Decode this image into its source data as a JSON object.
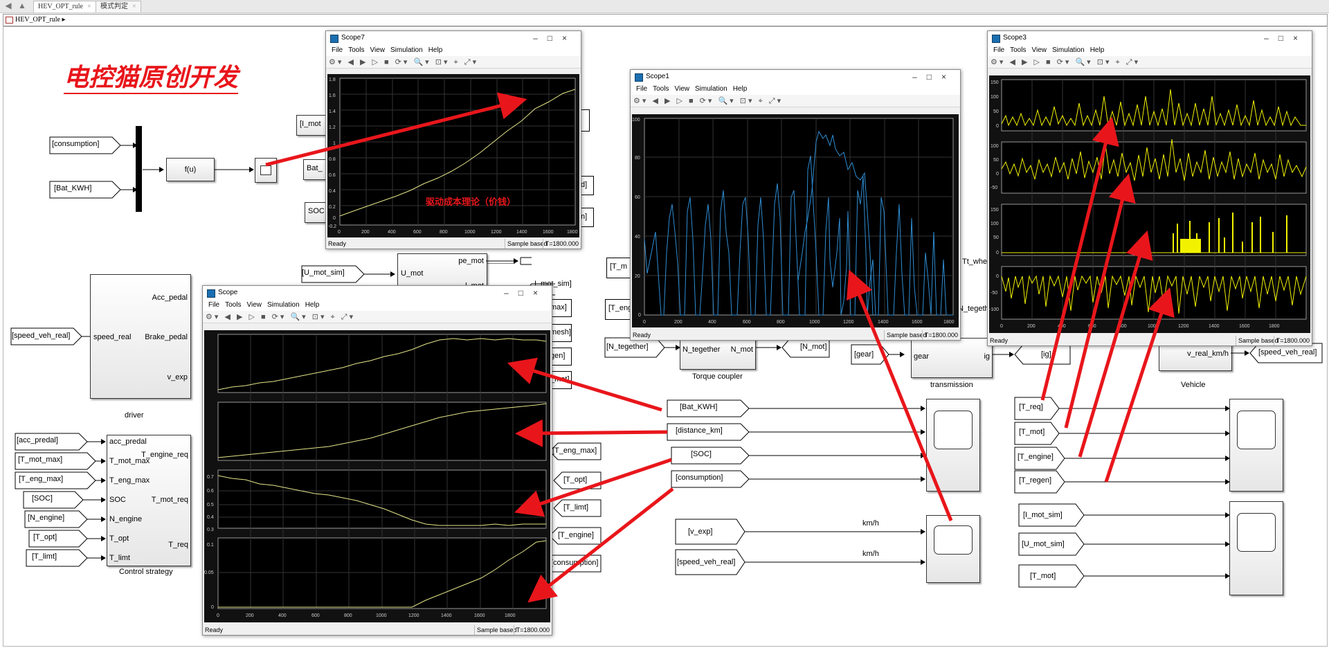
{
  "tabs": {
    "tab1": "HEV_OPT_rule",
    "tab2": "模式判定"
  },
  "address": {
    "path": "HEV_OPT_rule"
  },
  "banner": {
    "text": "电控猫原创开发"
  },
  "top_left": {
    "tag_consumption": "[consumption]",
    "tag_bat": "[Bat_KWH]",
    "fcn": "f(u)"
  },
  "hidden_tags": {
    "i_mot": "[I_mot",
    "bat": "Bat_",
    "soc": "SOC"
  },
  "driver": {
    "label": "driver",
    "in_speed": "speed_real",
    "out_acc": "Acc_pedal",
    "out_brake": "Brake_pedal",
    "out_vexp": "v_exp",
    "tag_speed": "[speed_veh_real]"
  },
  "motor": {
    "in": "U_mot",
    "out": "pe_mot",
    "tag_in": "[U_mot_sim]",
    "tag_out": "I_mot_sim]",
    "part_l": "l_mot"
  },
  "strategy": {
    "label": "Control strategy",
    "inputs": [
      "acc_predal",
      "T_mot_max",
      "T_eng_max",
      "SOC",
      "N_engine",
      "T_opt",
      "T_limt"
    ],
    "outputs": [
      "T_engine_req",
      "T_mot_req",
      "T_req"
    ],
    "tags_in": [
      "[acc_predal]",
      "[T_mot_max]",
      "[T_eng_max]",
      "[SOC]",
      "[N_engine]",
      "[T_opt]",
      "[T_limt]"
    ]
  },
  "right_tags": [
    "[T_eng_max]",
    "[T_opt]",
    "[T_limt]",
    "[T_engine]",
    "[consumption]"
  ],
  "partial_tags": [
    "max]",
    "mesh]",
    "gen]",
    "_mot]",
    "d]",
    "n]"
  ],
  "torque_coupler": {
    "label": "Torque coupler",
    "in": "N_tegether",
    "out": "N_mot",
    "tag_in": "[N_tegether]",
    "tag_out": "[N_mot]",
    "tag_t_eng": "[T_eng",
    "tag_t_m": "[T_m"
  },
  "transmission": {
    "label": "transmission",
    "in": "gear",
    "out": "ig",
    "tag_in": "[gear]",
    "tag_out": "[ig]",
    "tt": "Tt_whe",
    "n_teg": "N_tegeth"
  },
  "vehicle": {
    "label": "Vehicle",
    "out": "v_real_km/h",
    "tag_out": "[speed_veh_real]"
  },
  "mid_tags": [
    "[Bat_KWH]",
    "[distance_km]",
    "[SOC]",
    "[consumption]"
  ],
  "speed_tags": [
    "[v_exp]",
    "[speed_veh_real]"
  ],
  "kmh": [
    "km/h",
    "km/h"
  ],
  "torque_tags": [
    "[T_req]",
    "[T_mot]",
    "[T_engine]",
    "[T_regen]"
  ],
  "motor_tags": [
    "[I_mot_sim]",
    "[U_mot_sim]",
    "[T_mot]"
  ],
  "scope7": {
    "title": "Scope7",
    "menu": [
      "File",
      "Tools",
      "View",
      "Simulation",
      "Help"
    ],
    "annotation": "驱动成本理论（价钱）",
    "status": "Ready",
    "sample": "Sample based",
    "time": "T=1800.000",
    "yticks": [
      "1.8",
      "1.6",
      "1.4",
      "1.2",
      "1",
      "0.8",
      "0.6",
      "0.4",
      "0.2",
      "0",
      "-0.2"
    ],
    "xticks": [
      "0",
      "200",
      "400",
      "600",
      "800",
      "1000",
      "1200",
      "1400",
      "1600",
      "1800"
    ]
  },
  "scope1": {
    "title": "Scope1",
    "menu": [
      "File",
      "Tools",
      "View",
      "Simulation",
      "Help"
    ],
    "status": "Ready",
    "sample": "Sample based",
    "time": "T=1800.000",
    "yticks": [
      "100",
      "80",
      "60",
      "40",
      "20",
      "0"
    ],
    "xticks": [
      "0",
      "200",
      "400",
      "600",
      "800",
      "1000",
      "1200",
      "1400",
      "1600",
      "1800"
    ]
  },
  "scope3": {
    "title": "Scope3",
    "menu": [
      "File",
      "Tools",
      "View",
      "Simulation",
      "Help"
    ],
    "status": "Ready",
    "sample": "Sample based",
    "time": "T=1800.000",
    "yticks1": [
      "150",
      "100",
      "50",
      "0"
    ],
    "yticks2": [
      "100",
      "50",
      "0",
      "-50"
    ],
    "yticks3": [
      "150",
      "100",
      "50",
      "0"
    ],
    "yticks4": [
      "0",
      "-50",
      "-100"
    ],
    "xticks": [
      "0",
      "200",
      "400",
      "600",
      "800",
      "1000",
      "1200",
      "1400",
      "1600",
      "1800"
    ]
  },
  "scope": {
    "title": "Scope",
    "menu": [
      "File",
      "Tools",
      "View",
      "Simulation",
      "Help"
    ],
    "status": "Ready",
    "sample": "Sample based",
    "time": "T=1800.000",
    "yticks3": [
      "0.7",
      "0.6",
      "0.5",
      "0.4",
      "0.3"
    ],
    "yticks4": [
      "0.1",
      "0.05",
      "0"
    ],
    "xticks": [
      "0",
      "200",
      "400",
      "600",
      "800",
      "1000",
      "1200",
      "1400",
      "1600",
      "1800"
    ]
  },
  "colors": {
    "annotation_red": "#e8161b",
    "trace_yellow": "#e6e68a",
    "trace_blue": "#2f8fd6",
    "scope_bg": "#000000"
  }
}
